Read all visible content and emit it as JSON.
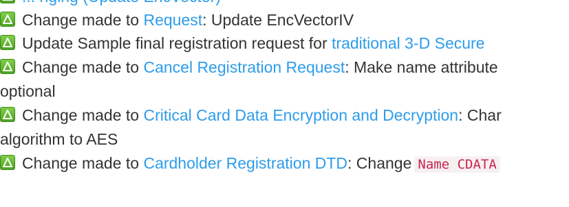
{
  "entries": [
    {
      "partial_header": "... nging (Update EncVector)",
      "prefix": "",
      "link": "",
      "suffix": ""
    },
    {
      "prefix": "Change made to ",
      "link": "Request",
      "suffix": ": Update EncVectorIV",
      "icon": "delta-change-icon"
    },
    {
      "prefix": "Update Sample final registration request for ",
      "link": "traditional 3-D Secure",
      "suffix": "",
      "icon": "delta-change-icon"
    },
    {
      "prefix": "Change made to ",
      "link": "Cancel Registration Request",
      "suffix": ": Make name attribute",
      "continuation": "optional",
      "icon": "delta-change-icon"
    },
    {
      "prefix": "Change made to ",
      "link": "Critical Card Data Encryption and Decryption",
      "suffix": ": Char",
      "continuation": "algorithm to AES",
      "icon": "delta-change-icon"
    },
    {
      "prefix": "Change made to ",
      "link": "Cardholder Registration DTD",
      "suffix": ": Change",
      "code": "Name CDATA",
      "icon": "delta-change-icon"
    }
  ],
  "colors": {
    "link": "#2e9cea",
    "icon": "#5cb82c",
    "code": "#c7254e"
  }
}
